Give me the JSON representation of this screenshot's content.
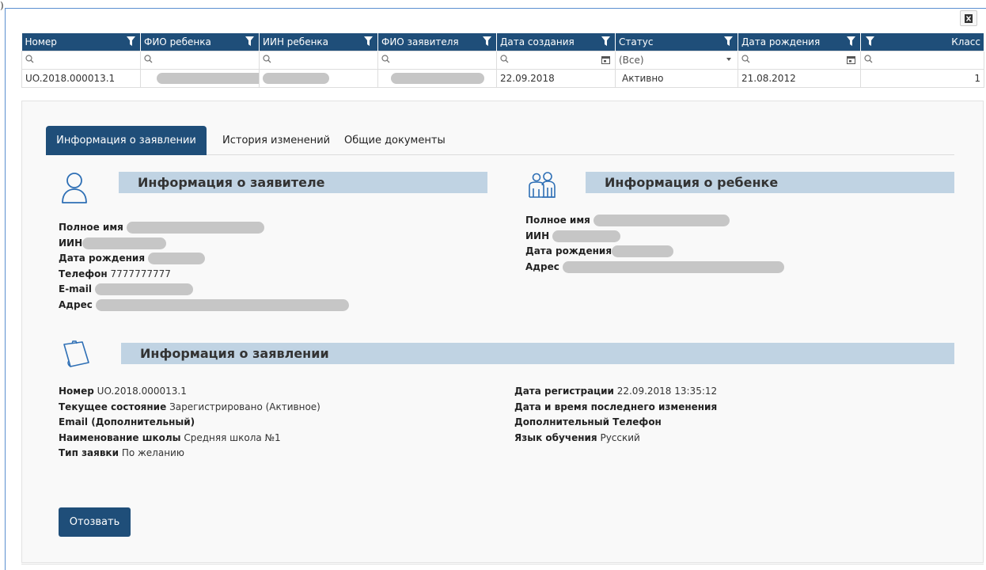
{
  "corner_mark": ")",
  "colors": {
    "header": "#1f4e79",
    "section": "#c0d3e3",
    "frame": "#5b8fd0"
  },
  "grid": {
    "columns": [
      {
        "label": "Номер"
      },
      {
        "label": "ФИО ребенка"
      },
      {
        "label": "ИИН ребенка"
      },
      {
        "label": "ФИО заявителя"
      },
      {
        "label": "Дата создания"
      },
      {
        "label": "Статус"
      },
      {
        "label": "Дата рождения"
      },
      {
        "label": "Класс"
      }
    ],
    "status_filter_value": "(Все)",
    "row": {
      "number": "UO.2018.000013.1",
      "created": "22.09.2018",
      "status": "Активно",
      "birth": "21.08.2012",
      "grade": "1"
    }
  },
  "tabs": [
    "Информация о заявлении",
    "История изменений",
    "Общие документы"
  ],
  "applicant": {
    "title": "Информация о заявителе",
    "full_name_label": "Полное имя",
    "iin_label": "ИИН",
    "birth_label": "Дата рождения",
    "phone_label": "Телефон",
    "phone_value": "7777777777",
    "email_label": "E-mail",
    "address_label": "Адрес"
  },
  "child": {
    "title": "Информация о ребенке",
    "full_name_label": "Полное имя",
    "iin_label": "ИИН",
    "birth_label": "Дата рождения",
    "address_label": "Адрес"
  },
  "application": {
    "title": "Информация о заявлении",
    "number_label": "Номер",
    "number_value": "UO.2018.000013.1",
    "state_label": "Текущее состояние",
    "state_value": "Зарегистрировано (Активное)",
    "email_label": "Email (Дополнительный)",
    "school_label": "Наименование школы",
    "school_value": "Средняя школа №1",
    "type_label": "Тип заявки",
    "type_value": "По желанию",
    "reg_date_label": "Дата регистрации",
    "reg_date_value": "22.09.2018 13:35:12",
    "last_change_label": "Дата и время последнего изменения",
    "extra_phone_label": "Дополнительный Телефон",
    "language_label": "Язык обучения",
    "language_value": "Русский"
  },
  "revoke_label": "Отозвать"
}
